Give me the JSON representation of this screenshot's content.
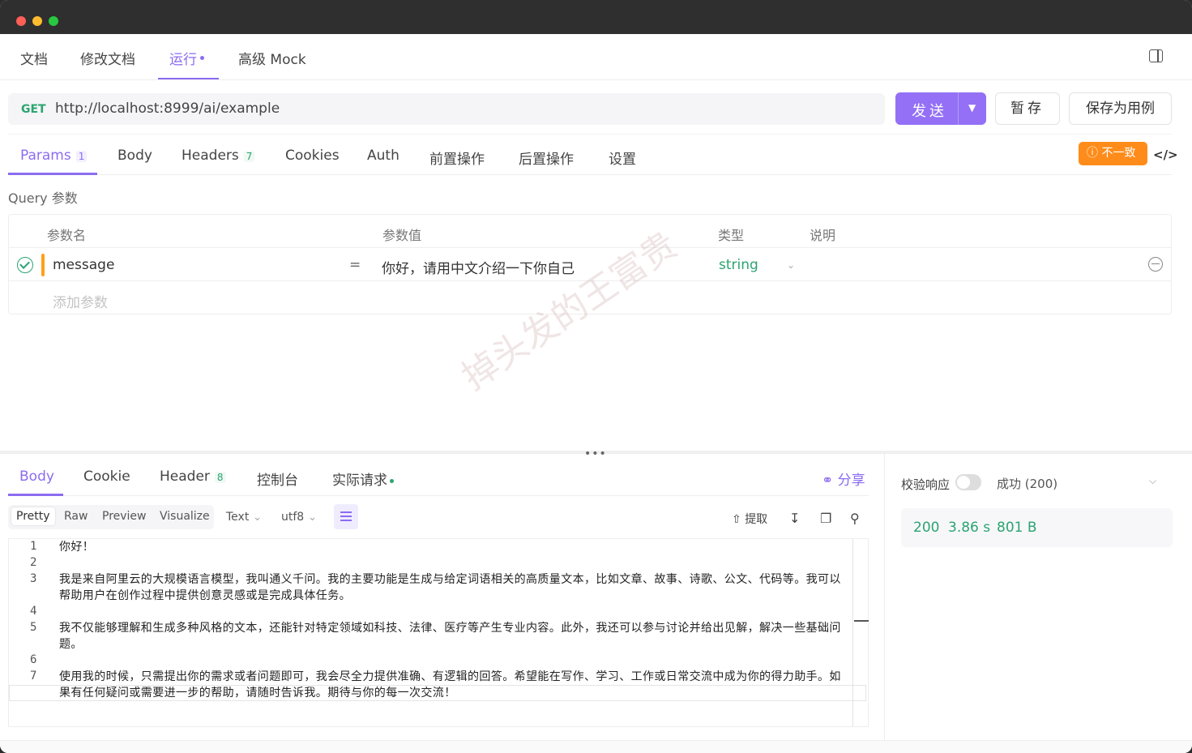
{
  "top_tabs": {
    "doc": "文档",
    "edit": "修改文档",
    "run": "运行",
    "mock": "高级 Mock"
  },
  "request": {
    "method": "GET",
    "url": "http://localhost:8999/ai/example",
    "send_label": "发送",
    "temp_save_label": "暂存",
    "save_case_label": "保存为用例"
  },
  "request_tabs": {
    "params": "Params",
    "params_count": "1",
    "body": "Body",
    "headers": "Headers",
    "headers_count": "7",
    "cookies": "Cookies",
    "auth": "Auth",
    "pre": "前置操作",
    "post": "后置操作",
    "settings": "设置"
  },
  "inconsistent_label": "不一致",
  "query": {
    "label": "Query 参数",
    "headers": {
      "name": "参数名",
      "value": "参数值",
      "type": "类型",
      "desc": "说明"
    },
    "rows": [
      {
        "name": "message",
        "eq": "=",
        "value": "你好，请用中文介绍一下你自己",
        "type": "string"
      }
    ],
    "add_placeholder": "添加参数"
  },
  "watermark": "掉头发的王富贵",
  "response_tabs": {
    "body": "Body",
    "cookie": "Cookie",
    "header": "Header",
    "header_count": "8",
    "console": "控制台",
    "actual": "实际请求"
  },
  "share_label": "分享",
  "formats": {
    "pretty": "Pretty",
    "raw": "Raw",
    "preview": "Preview",
    "visualize": "Visualize",
    "text": "Text",
    "encoding": "utf8"
  },
  "tools": {
    "extract": "提取"
  },
  "editor": {
    "line_numbers": [
      "1",
      "2",
      "3",
      "4",
      "5",
      "6",
      "7"
    ],
    "lines": [
      "你好！",
      "",
      "我是来自阿里云的大规模语言模型，我叫通义千问。我的主要功能是生成与给定词语相关的高质量文本，比如文章、故事、诗歌、公文、代码等。我可以帮助用户在创作过程中提供创意灵感或是完成具体任务。",
      "",
      "我不仅能够理解和生成多种风格的文本，还能针对特定领域如科技、法律、医疗等产生专业内容。此外，我还可以参与讨论并给出见解，解决一些基础问题。",
      "",
      "使用我的时候，只需提出你的需求或者问题即可，我会尽全力提供准确、有逻辑的回答。希望能在写作、学习、工作或日常交流中成为你的得力助手。如果有任何疑问或需要进一步的帮助，请随时告诉我。期待与你的每一次交流！"
    ]
  },
  "response_meta": {
    "verify_label": "校验响应",
    "status_text": "成功 (200)",
    "code": "200",
    "time": "3.86 s",
    "size": "801 B"
  },
  "colors": {
    "accent": "#8c6cf0",
    "success": "#2ba471",
    "warning": "#ff8c1a"
  }
}
